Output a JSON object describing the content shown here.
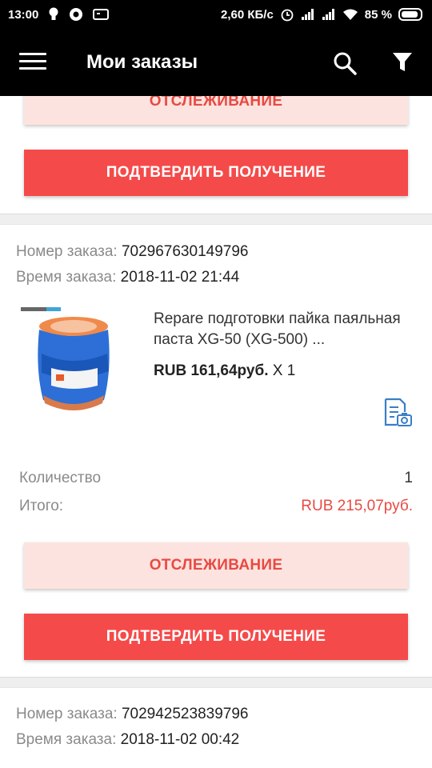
{
  "status_bar": {
    "time": "13:00",
    "speed": "2,60 КБ/с",
    "battery": "85 %",
    "icons": [
      "bulb-icon",
      "chrome-icon",
      "gamepad-icon",
      "alarm-icon",
      "signal-icon",
      "signal-icon",
      "wifi-icon",
      "battery-icon"
    ]
  },
  "app_bar": {
    "title": "Мои заказы",
    "icons": [
      "menu-icon",
      "search-icon",
      "filter-icon"
    ]
  },
  "orders": [
    {
      "track_label": "ОТСЛЕЖИВАНИЕ",
      "confirm_label": "ПОДТВЕРДИТЬ ПОЛУЧЕНИЕ"
    },
    {
      "order_number_label": "Номер заказа:",
      "order_number": "702967630149796",
      "order_time_label": "Время заказа:",
      "order_time": "2018-11-02 21:44",
      "product_title": "Repare подготовки пайка паяльная паста XG-50 (XG-500) ...",
      "product_price": "RUB 161,64руб.",
      "product_qty": "X 1",
      "quantity_label": "Количество",
      "quantity_value": "1",
      "total_label": "Итого:",
      "total_value": "RUB 215,07руб.",
      "track_label": "ОТСЛЕЖИВАНИЕ",
      "confirm_label": "ПОДТВЕРДИТЬ ПОЛУЧЕНИЕ"
    },
    {
      "order_number_label": "Номер заказа:",
      "order_number": "702942523839796",
      "order_time_label": "Время заказа:",
      "order_time": "2018-11-02 00:42"
    }
  ],
  "colors": {
    "accent": "#f54a4a",
    "track_bg": "#fde3df",
    "track_text": "#e84a42",
    "total_red": "#e84a42"
  }
}
